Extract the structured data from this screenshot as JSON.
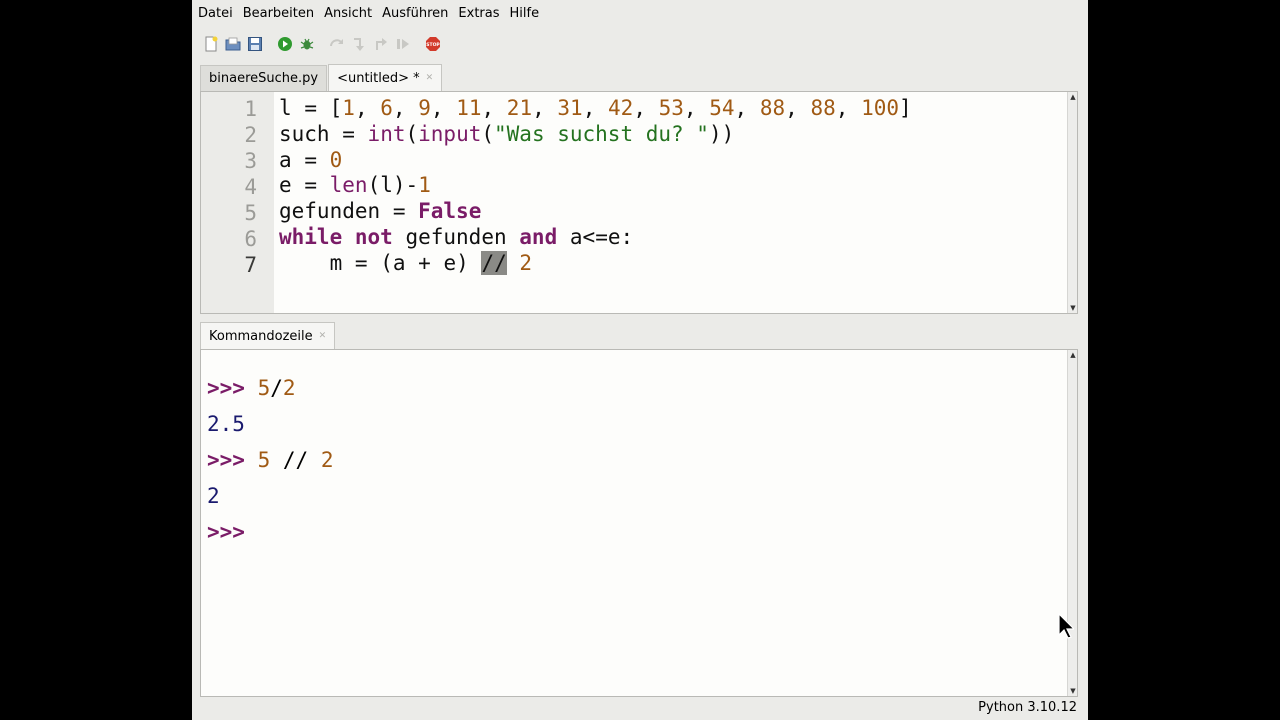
{
  "menu": [
    "Datei",
    "Bearbeiten",
    "Ansicht",
    "Ausführen",
    "Extras",
    "Hilfe"
  ],
  "toolbar": {
    "icons": [
      "new-file-icon",
      "open-file-icon",
      "save-file-icon",
      "run-icon",
      "debug-icon",
      "step-over-icon",
      "step-into-icon",
      "step-out-icon",
      "resume-icon",
      "stop-icon"
    ],
    "stop_label": "STOP"
  },
  "editor_tabs": [
    {
      "label": "binaereSuche.py",
      "active": false
    },
    {
      "label": "<untitled> *",
      "active": true
    }
  ],
  "editor": {
    "line_numbers": [
      "1",
      "2",
      "3",
      "4",
      "5",
      "6",
      "7"
    ],
    "current_line": "7",
    "code_lines": [
      "l = [1, 6, 9, 11, 21, 31, 42, 53, 54, 88, 88, 100]",
      "such = int(input(\"Was suchst du? \"))",
      "a = 0",
      "e = len(l)-1",
      "gefunden = False",
      "while not gefunden and a<=e:",
      "    m = (a + e) // 2"
    ],
    "selected_text": "//"
  },
  "shell_tab": {
    "label": "Kommandozeile"
  },
  "shell": {
    "prompt": ">>>",
    "lines": [
      {
        "kind": "input",
        "text": "5/2"
      },
      {
        "kind": "output",
        "text": "2.5"
      },
      {
        "kind": "input",
        "text": "5 // 2"
      },
      {
        "kind": "output",
        "text": "2"
      },
      {
        "kind": "input",
        "text": ""
      }
    ]
  },
  "status": {
    "interpreter": "Python 3.10.12"
  },
  "colors": {
    "keyword": "#7a1c67",
    "number": "#a05a14",
    "string": "#24721f",
    "output": "#1a1a6e",
    "selection": "#8a8a86"
  }
}
